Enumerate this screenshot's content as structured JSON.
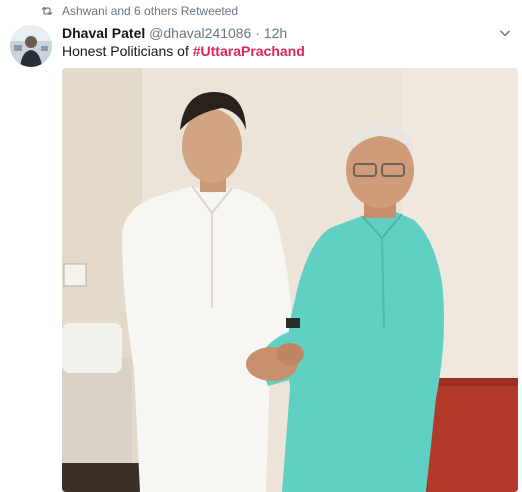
{
  "retweet": {
    "text": "Ashwani and 6 others Retweeted",
    "icon": "retweet-icon"
  },
  "tweet": {
    "author_name": "Dhaval Patel",
    "handle": "@dhaval241086",
    "separator": "·",
    "time": "12h",
    "text_prefix": "Honest Politicians of ",
    "hashtag": "#UttaraPrachand",
    "hashtag_color": "#e0245e"
  },
  "photo": {
    "alt": ""
  }
}
